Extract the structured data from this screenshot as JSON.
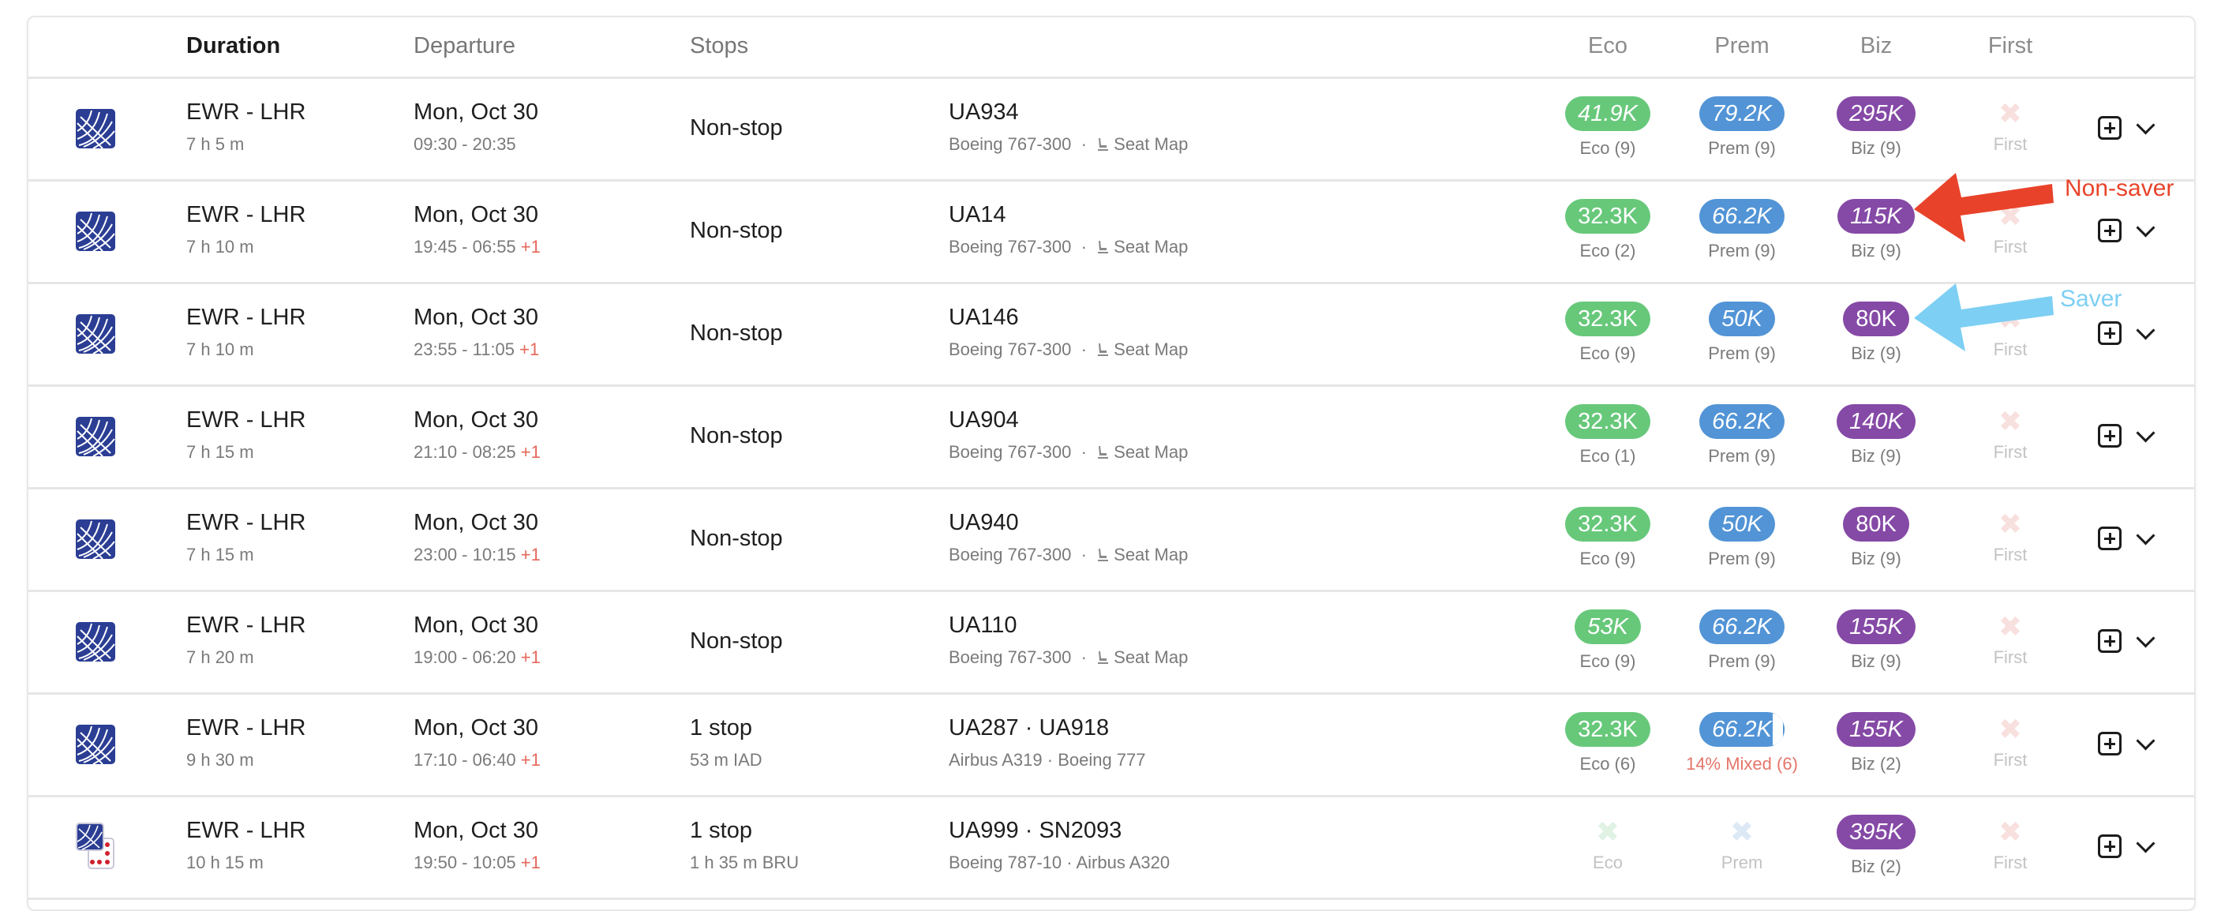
{
  "header": {
    "duration": "Duration",
    "departure": "Departure",
    "stops": "Stops",
    "eco": "Eco",
    "prem": "Prem",
    "biz": "Biz",
    "first": "First"
  },
  "colors": {
    "eco": "#67c87a",
    "prem": "#5294d6",
    "biz": "#8549a6",
    "non_saver_annotation": "#e8432a",
    "saver_annotation": "#7dcff3",
    "next_day": "#e5675a"
  },
  "rows": [
    {
      "logo": "united-logo",
      "route": "EWR - LHR",
      "duration": "7 h 5 m",
      "date": "Mon, Oct 30",
      "times": "09:30 - 20:35",
      "next_day": "",
      "stops": "Non-stop",
      "stop_detail": "",
      "flight": "UA934",
      "aircraft": "Boeing 767-300",
      "seat_map": "Seat Map",
      "eco": {
        "price": "41.9K",
        "label": "Eco (9)",
        "saver": false
      },
      "prem": {
        "price": "79.2K",
        "label": "Prem (9)",
        "saver": false
      },
      "biz": {
        "price": "295K",
        "label": "Biz (9)",
        "saver": false
      },
      "first": {
        "price": null,
        "label": "First"
      }
    },
    {
      "logo": "united-logo",
      "route": "EWR - LHR",
      "duration": "7 h 10 m",
      "date": "Mon, Oct 30",
      "times": "19:45 - 06:55",
      "next_day": "+1",
      "stops": "Non-stop",
      "stop_detail": "",
      "flight": "UA14",
      "aircraft": "Boeing 767-300",
      "seat_map": "Seat Map",
      "eco": {
        "price": "32.3K",
        "label": "Eco (2)",
        "saver": true
      },
      "prem": {
        "price": "66.2K",
        "label": "Prem (9)",
        "saver": false
      },
      "biz": {
        "price": "115K",
        "label": "Biz (9)",
        "saver": false
      },
      "first": {
        "price": null,
        "label": "First"
      }
    },
    {
      "logo": "united-logo",
      "route": "EWR - LHR",
      "duration": "7 h 10 m",
      "date": "Mon, Oct 30",
      "times": "23:55 - 11:05",
      "next_day": "+1",
      "stops": "Non-stop",
      "stop_detail": "",
      "flight": "UA146",
      "aircraft": "Boeing 767-300",
      "seat_map": "Seat Map",
      "eco": {
        "price": "32.3K",
        "label": "Eco (9)",
        "saver": true
      },
      "prem": {
        "price": "50K",
        "label": "Prem (9)",
        "saver": false
      },
      "biz": {
        "price": "80K",
        "label": "Biz (9)",
        "saver": true
      },
      "first": {
        "price": null,
        "label": "First"
      }
    },
    {
      "logo": "united-logo",
      "route": "EWR - LHR",
      "duration": "7 h 15 m",
      "date": "Mon, Oct 30",
      "times": "21:10 - 08:25",
      "next_day": "+1",
      "stops": "Non-stop",
      "stop_detail": "",
      "flight": "UA904",
      "aircraft": "Boeing 767-300",
      "seat_map": "Seat Map",
      "eco": {
        "price": "32.3K",
        "label": "Eco (1)",
        "saver": true
      },
      "prem": {
        "price": "66.2K",
        "label": "Prem (9)",
        "saver": false
      },
      "biz": {
        "price": "140K",
        "label": "Biz (9)",
        "saver": false
      },
      "first": {
        "price": null,
        "label": "First"
      }
    },
    {
      "logo": "united-logo",
      "route": "EWR - LHR",
      "duration": "7 h 15 m",
      "date": "Mon, Oct 30",
      "times": "23:00 - 10:15",
      "next_day": "+1",
      "stops": "Non-stop",
      "stop_detail": "",
      "flight": "UA940",
      "aircraft": "Boeing 767-300",
      "seat_map": "Seat Map",
      "eco": {
        "price": "32.3K",
        "label": "Eco (9)",
        "saver": true
      },
      "prem": {
        "price": "50K",
        "label": "Prem (9)",
        "saver": false
      },
      "biz": {
        "price": "80K",
        "label": "Biz (9)",
        "saver": true
      },
      "first": {
        "price": null,
        "label": "First"
      }
    },
    {
      "logo": "united-logo",
      "route": "EWR - LHR",
      "duration": "7 h 20 m",
      "date": "Mon, Oct 30",
      "times": "19:00 - 06:20",
      "next_day": "+1",
      "stops": "Non-stop",
      "stop_detail": "",
      "flight": "UA110",
      "aircraft": "Boeing 767-300",
      "seat_map": "Seat Map",
      "eco": {
        "price": "53K",
        "label": "Eco (9)",
        "saver": false
      },
      "prem": {
        "price": "66.2K",
        "label": "Prem (9)",
        "saver": false
      },
      "biz": {
        "price": "155K",
        "label": "Biz (9)",
        "saver": false
      },
      "first": {
        "price": null,
        "label": "First"
      }
    },
    {
      "logo": "united-logo",
      "route": "EWR - LHR",
      "duration": "9 h 30 m",
      "date": "Mon, Oct 30",
      "times": "17:10 - 06:40",
      "next_day": "+1",
      "stops": "1 stop",
      "stop_detail": "53 m  IAD",
      "flight": "UA287  ·  UA918",
      "aircraft": "Airbus A319  ·  Boeing 777",
      "seat_map": "",
      "eco": {
        "price": "32.3K",
        "label": "Eco (6)",
        "saver": true
      },
      "prem": {
        "price": "66.2K",
        "label": "14% Mixed (6)",
        "saver": false,
        "mixed_percent": 14
      },
      "biz": {
        "price": "155K",
        "label": "Biz (2)",
        "saver": false
      },
      "first": {
        "price": null,
        "label": "First"
      }
    },
    {
      "logo": "united-brussels-logo",
      "route": "EWR - LHR",
      "duration": "10 h 15 m",
      "date": "Mon, Oct 30",
      "times": "19:50 - 10:05",
      "next_day": "+1",
      "stops": "1 stop",
      "stop_detail": "1 h 35 m  BRU",
      "flight": "UA999  ·  SN2093",
      "aircraft": "Boeing 787-10  ·  Airbus A320",
      "seat_map": "",
      "eco": {
        "price": null,
        "label": "Eco"
      },
      "prem": {
        "price": null,
        "label": "Prem"
      },
      "biz": {
        "price": "395K",
        "label": "Biz (2)",
        "saver": false
      },
      "first": {
        "price": null,
        "label": "First"
      }
    }
  ],
  "annotations": {
    "non_saver": "Non-saver",
    "saver": "Saver"
  },
  "icons": {
    "add": "plus-square-icon",
    "expand": "chevron-down-icon",
    "seat": "seat-icon",
    "unavailable": "x-icon"
  }
}
